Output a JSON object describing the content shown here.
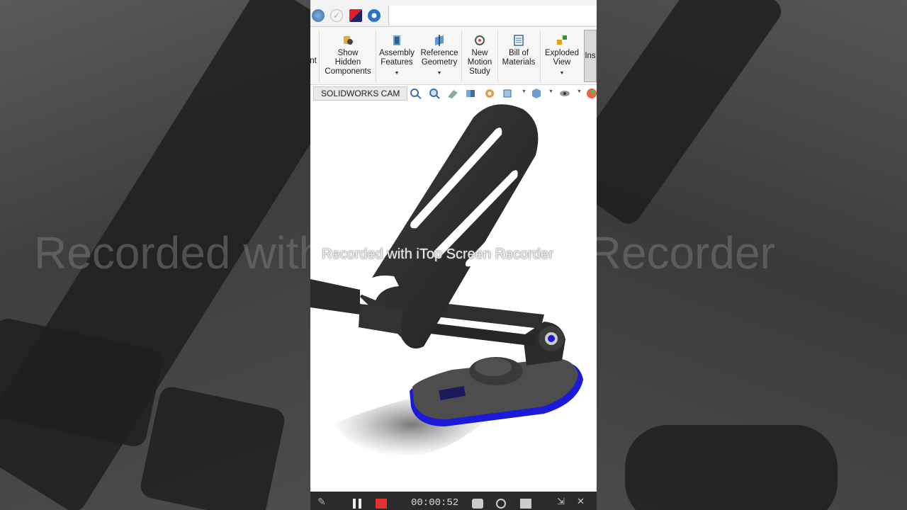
{
  "ribbon": {
    "partial_left": "nt",
    "show_hidden": [
      "Show",
      "Hidden",
      "Components"
    ],
    "assembly_features": [
      "Assembly",
      "Features"
    ],
    "reference_geometry": [
      "Reference",
      "Geometry"
    ],
    "new_motion_study": [
      "New",
      "Motion",
      "Study"
    ],
    "bill_of_materials": [
      "Bill of",
      "Materials"
    ],
    "exploded_view": [
      "Exploded",
      "View"
    ],
    "partial_right": "Ins"
  },
  "tabs": {
    "cam": "SOLIDWORKS CAM"
  },
  "watermark": "Recorded with iTop Screen Recorder",
  "bg_watermark": "Recorded with iTop Screen Recorder",
  "recorder": {
    "timer": "00:00:52"
  },
  "colors": {
    "accent_blue": "#1a1adf",
    "part_dark": "#2a2a2a"
  }
}
